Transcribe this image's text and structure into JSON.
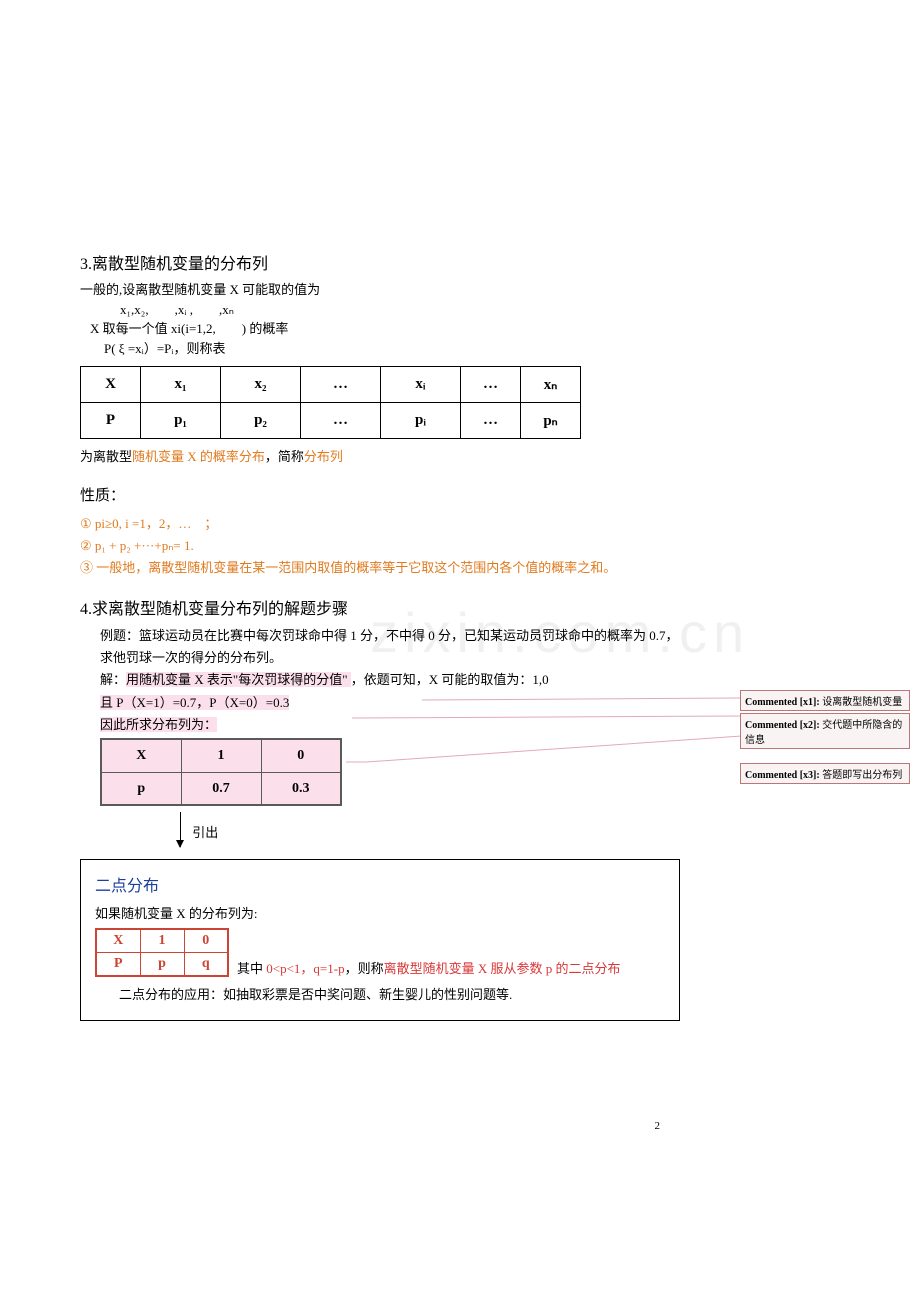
{
  "section3": {
    "title": "3.离散型随机变量的分布列",
    "intro": "一般的,设离散型随机变量 X 可能取的值为",
    "values_line": "x₁,x₂,　　,xᵢ ,　　,xₙ",
    "line2": "X 取每一个值  xi(i=1,2,　　) 的概率",
    "line3": "P( ξ =xᵢ）=Pᵢ，则称表",
    "table": {
      "row1": [
        "X",
        "x₁",
        "x₂",
        "…",
        "xᵢ",
        "…",
        "xₙ"
      ],
      "row2": [
        "P",
        "p₁",
        "p₂",
        "…",
        "pᵢ",
        "…",
        "pₙ"
      ]
    },
    "after_pre": "为离散型",
    "after_mid": "随机变量 X  的概率分布",
    "after_comma": "，简称",
    "after_end": "分布列"
  },
  "properties": {
    "title": "性质：",
    "p1": "① pi≥0, i =1，2，…　；",
    "p2": "② p₁ + p₂ +···+pₙ= 1.",
    "p3": "③ 一般地，离散型随机变量在某一范围内取值的概率等于它取这个范围内各个值的概率之和。"
  },
  "section4": {
    "title": "4.求离散型随机变量分布列的解题步骤",
    "ex_label": "例题：",
    "ex_text": "篮球运动员在比赛中每次罚球命中得 1 分，不中得 0 分，已知某运动员罚球命中的概率为 0.7，求他罚球一次的得分的分布列。",
    "sol_label": "解：",
    "sol_hl1": "用随机变量 X 表示\"每次罚球得的分值\" ",
    "sol_mid": "，依题可知，X 可能的取值为：1,0",
    "sol_hl2": "且 P（X=1）=0.7，P（X=0）=0.3",
    "sol_hl3": "因此所求分布列为：",
    "table": {
      "row1": [
        "X",
        "1",
        "0"
      ],
      "row2": [
        "p",
        "0.7",
        "0.3"
      ]
    },
    "arrow_label": "引出"
  },
  "twopoint": {
    "title": "二点分布",
    "intro": "如果随机变量 X 的分布列为:",
    "table": {
      "row1": [
        "X",
        "1",
        "0"
      ],
      "row2": [
        "P",
        "p",
        "q"
      ]
    },
    "note_pre": "其中 ",
    "note_red1": "0<p<1，q=1-p",
    "note_mid": "，则称",
    "note_red2": "离散型随机变量 X 服从参数 p 的二点分布",
    "app": "二点分布的应用：如抽取彩票是否中奖问题、新生婴儿的性别问题等."
  },
  "comments": {
    "c1_label": "Commented [x1]: ",
    "c1_text": "设离散型随机变量",
    "c2_label": "Commented [x2]: ",
    "c2_text": "交代题中所隐含的信息",
    "c3_label": "Commented [x3]: ",
    "c3_text": "答题即写出分布列"
  },
  "page_num": "2",
  "watermark": "zixin.com.cn"
}
